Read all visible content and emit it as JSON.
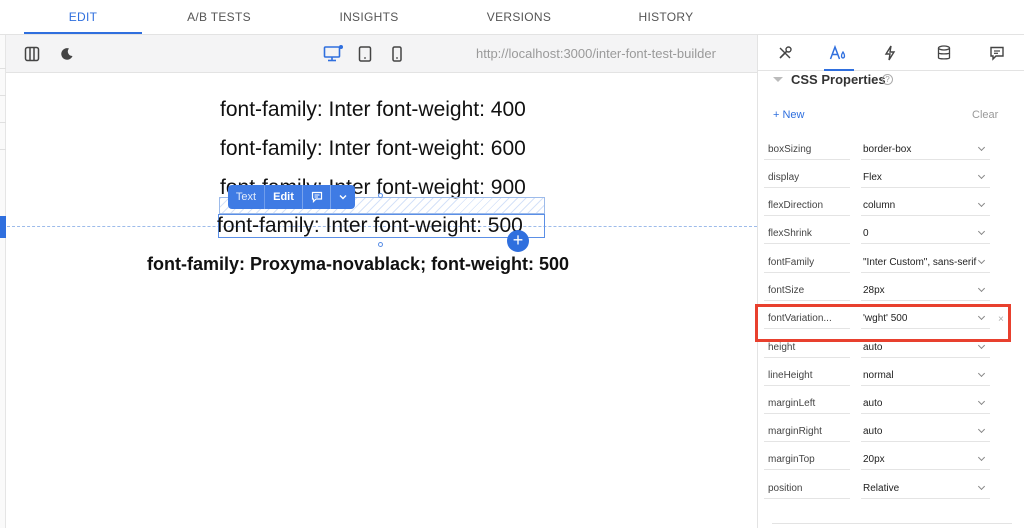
{
  "top_tabs": [
    {
      "label": "EDIT",
      "active": true
    },
    {
      "label": "A/B TESTS",
      "active": false
    },
    {
      "label": "INSIGHTS",
      "active": false
    },
    {
      "label": "VERSIONS",
      "active": false
    },
    {
      "label": "HISTORY",
      "active": false
    }
  ],
  "toolbar": {
    "url": "http://localhost:3000/inter-font-test-builder",
    "icons": [
      "columns-icon",
      "moon-icon",
      "desktop-icon",
      "tablet-icon",
      "mobile-icon"
    ]
  },
  "canvas": {
    "lines": [
      "font-family: Inter font-weight: 400",
      "font-family: Inter font-weight: 600",
      "font-family: Inter font-weight: 900",
      "font-family: Inter font-weight: 500"
    ],
    "proxyma_line": "font-family: Proxyma-novablack; font-weight: 500",
    "popup": {
      "text_label": "Text",
      "edit_label": "Edit"
    }
  },
  "panel": {
    "tabs": [
      "tools-icon",
      "style-icon",
      "bolt-icon",
      "database-icon",
      "comment-icon"
    ],
    "section_title": "CSS Properties",
    "help_glyph": "?",
    "new_label": "+ New",
    "clear_label": "Clear",
    "close_glyph": "×",
    "properties": [
      {
        "name": "boxSizing",
        "value": "border-box"
      },
      {
        "name": "display",
        "value": "Flex"
      },
      {
        "name": "flexDirection",
        "value": "column"
      },
      {
        "name": "flexShrink",
        "value": "0"
      },
      {
        "name": "fontFamily",
        "value": "\"Inter Custom\", sans-serif"
      },
      {
        "name": "fontSize",
        "value": "28px"
      },
      {
        "name": "fontVariation...",
        "value": "'wght' 500"
      },
      {
        "name": "height",
        "value": "auto"
      },
      {
        "name": "lineHeight",
        "value": "normal"
      },
      {
        "name": "marginLeft",
        "value": "auto"
      },
      {
        "name": "marginRight",
        "value": "auto"
      },
      {
        "name": "marginTop",
        "value": "20px"
      },
      {
        "name": "position",
        "value": "Relative"
      }
    ]
  },
  "colors": {
    "accent": "#2f6fde",
    "highlight": "#e8402e"
  }
}
